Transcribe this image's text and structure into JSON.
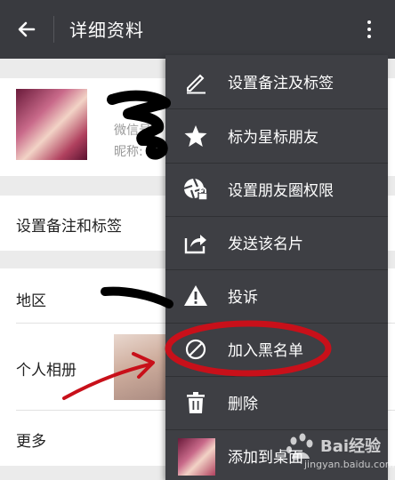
{
  "topbar": {
    "title": "详细资料",
    "back_icon": "arrow-left-icon",
    "more_icon": "more-vertical-icon"
  },
  "profile": {
    "wechat_id_label": "微信号",
    "nickname_label": "昵称:"
  },
  "rows": {
    "tags_label": "设置备注和标签",
    "region_label": "地区",
    "region_value": "",
    "album_label": "个人相册",
    "more_label": "更多"
  },
  "menu": {
    "items": [
      {
        "label": "设置备注及标签",
        "icon": "pencil-icon"
      },
      {
        "label": "标为星标朋友",
        "icon": "star-icon"
      },
      {
        "label": "设置朋友圈权限",
        "icon": "aperture-lock-icon"
      },
      {
        "label": "发送该名片",
        "icon": "share-icon"
      },
      {
        "label": "投诉",
        "icon": "warning-icon"
      },
      {
        "label": "加入黑名单",
        "icon": "block-icon"
      },
      {
        "label": "删除",
        "icon": "trash-icon"
      },
      {
        "label": "添加到桌面",
        "icon": "desktop-thumbnail"
      }
    ]
  },
  "watermark": {
    "brand": "Bai经验",
    "url": "jingyan.baidu.com"
  },
  "colors": {
    "topbar": "#393a3f",
    "menu": "#3e3f44",
    "annotation_red": "#c8101a"
  }
}
